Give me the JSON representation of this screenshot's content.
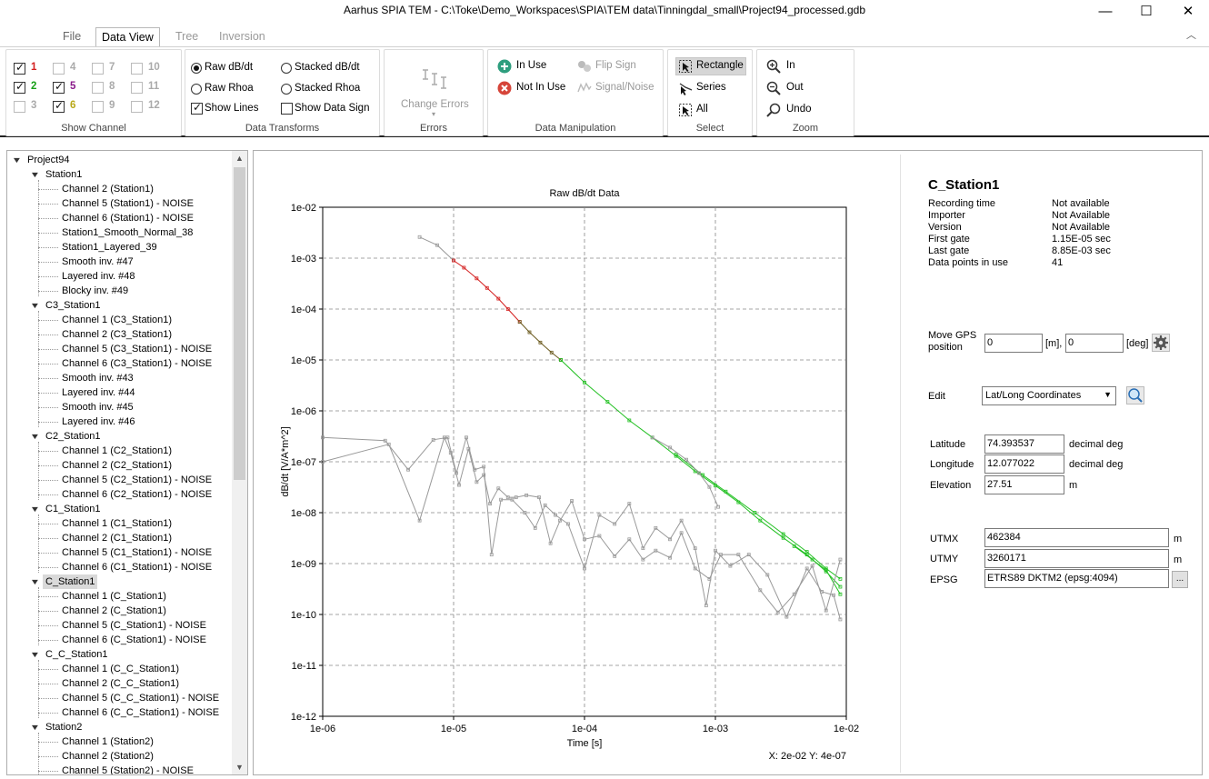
{
  "window": {
    "title": "Aarhus SPIA TEM - C:\\Toke\\Demo_Workspaces\\SPIA\\TEM data\\Tinningdal_small\\Project94_processed.gdb",
    "min": "—",
    "max": "☐",
    "close": "✕"
  },
  "tabs": [
    "File",
    "Data View",
    "Tree",
    "Inversion"
  ],
  "ribbon": {
    "show_channel": {
      "label": "Show Channel",
      "channels": [
        {
          "num": "1",
          "checked": true,
          "color": "#d42020"
        },
        {
          "num": "2",
          "checked": true,
          "color": "#18a018"
        },
        {
          "num": "3",
          "checked": false,
          "color": "#aaaaaa"
        },
        {
          "num": "4",
          "checked": false,
          "color": "#aaaaaa"
        },
        {
          "num": "5",
          "checked": true,
          "color": "#8a1a8a"
        },
        {
          "num": "6",
          "checked": true,
          "color": "#b8a818"
        },
        {
          "num": "7",
          "checked": false,
          "color": "#aaaaaa"
        },
        {
          "num": "8",
          "checked": false,
          "color": "#aaaaaa"
        },
        {
          "num": "9",
          "checked": false,
          "color": "#aaaaaa"
        },
        {
          "num": "10",
          "checked": false,
          "color": "#aaaaaa"
        },
        {
          "num": "11",
          "checked": false,
          "color": "#aaaaaa"
        },
        {
          "num": "12",
          "checked": false,
          "color": "#aaaaaa"
        }
      ]
    },
    "data_transforms": {
      "label": "Data Transforms",
      "raw_dbdt": "Raw dB/dt",
      "raw_rhoa": "Raw Rhoa",
      "stacked_dbdt": "Stacked dB/dt",
      "stacked_rhoa": "Stacked Rhoa",
      "show_lines": "Show Lines",
      "show_data_sign": "Show Data Sign"
    },
    "errors": {
      "label": "Errors",
      "change_errors": "Change Errors"
    },
    "data_manipulation": {
      "label": "Data Manipulation",
      "in_use": "In Use",
      "not_in_use": "Not In Use",
      "flip_sign": "Flip Sign",
      "signal_noise": "Signal/Noise"
    },
    "select": {
      "label": "Select",
      "rectangle": "Rectangle",
      "series": "Series",
      "all": "All"
    },
    "zoom": {
      "label": "Zoom",
      "in": "In",
      "out": "Out",
      "undo": "Undo"
    }
  },
  "tree": [
    {
      "level": 0,
      "label": "Project94",
      "expand": true
    },
    {
      "level": 1,
      "label": "Station1",
      "expand": true
    },
    {
      "level": 2,
      "label": "Channel 2 (Station1)"
    },
    {
      "level": 2,
      "label": "Channel 5 (Station1) - NOISE"
    },
    {
      "level": 2,
      "label": "Channel 6 (Station1) - NOISE"
    },
    {
      "level": 2,
      "label": "Station1_Smooth_Normal_38"
    },
    {
      "level": 2,
      "label": "Station1_Layered_39"
    },
    {
      "level": 2,
      "label": "Smooth inv.  #47"
    },
    {
      "level": 2,
      "label": "Layered inv.  #48"
    },
    {
      "level": 2,
      "label": "Blocky inv.  #49"
    },
    {
      "level": 1,
      "label": "C3_Station1",
      "expand": true
    },
    {
      "level": 2,
      "label": "Channel 1 (C3_Station1)"
    },
    {
      "level": 2,
      "label": "Channel 2 (C3_Station1)"
    },
    {
      "level": 2,
      "label": "Channel 5 (C3_Station1) - NOISE"
    },
    {
      "level": 2,
      "label": "Channel 6 (C3_Station1) - NOISE"
    },
    {
      "level": 2,
      "label": "Smooth inv.  #43"
    },
    {
      "level": 2,
      "label": "Layered inv.  #44"
    },
    {
      "level": 2,
      "label": "Smooth inv.  #45"
    },
    {
      "level": 2,
      "label": "Layered inv.  #46"
    },
    {
      "level": 1,
      "label": "C2_Station1",
      "expand": true
    },
    {
      "level": 2,
      "label": "Channel 1 (C2_Station1)"
    },
    {
      "level": 2,
      "label": "Channel 2 (C2_Station1)"
    },
    {
      "level": 2,
      "label": "Channel 5 (C2_Station1) - NOISE"
    },
    {
      "level": 2,
      "label": "Channel 6 (C2_Station1) - NOISE"
    },
    {
      "level": 1,
      "label": "C1_Station1",
      "expand": true
    },
    {
      "level": 2,
      "label": "Channel 1 (C1_Station1)"
    },
    {
      "level": 2,
      "label": "Channel 2 (C1_Station1)"
    },
    {
      "level": 2,
      "label": "Channel 5 (C1_Station1) - NOISE"
    },
    {
      "level": 2,
      "label": "Channel 6 (C1_Station1) - NOISE"
    },
    {
      "level": 1,
      "label": "C_Station1",
      "expand": true,
      "selected": true
    },
    {
      "level": 2,
      "label": "Channel 1 (C_Station1)"
    },
    {
      "level": 2,
      "label": "Channel 2 (C_Station1)"
    },
    {
      "level": 2,
      "label": "Channel 5 (C_Station1) - NOISE"
    },
    {
      "level": 2,
      "label": "Channel 6 (C_Station1) - NOISE"
    },
    {
      "level": 1,
      "label": "C_C_Station1",
      "expand": true
    },
    {
      "level": 2,
      "label": "Channel 1 (C_C_Station1)"
    },
    {
      "level": 2,
      "label": "Channel 2 (C_C_Station1)"
    },
    {
      "level": 2,
      "label": "Channel 5 (C_C_Station1) - NOISE"
    },
    {
      "level": 2,
      "label": "Channel 6 (C_C_Station1) - NOISE"
    },
    {
      "level": 1,
      "label": "Station2",
      "expand": true
    },
    {
      "level": 2,
      "label": "Channel 1 (Station2)"
    },
    {
      "level": 2,
      "label": "Channel 2 (Station2)"
    },
    {
      "level": 2,
      "label": "Channel 5 (Station2) - NOISE"
    }
  ],
  "chart_data": {
    "type": "line",
    "title": "Raw dB/dt Data",
    "xlabel": "Time [s]",
    "ylabel": "dB/dt [V/A*m^2]",
    "xscale": "log",
    "yscale": "log",
    "xlim": [
      1e-06,
      0.01
    ],
    "ylim": [
      1e-12,
      0.01
    ],
    "x_ticks": [
      "1e-06",
      "1e-05",
      "1e-04",
      "1e-03",
      "1e-02"
    ],
    "y_ticks": [
      "1e-02",
      "1e-03",
      "1e-04",
      "1e-05",
      "1e-06",
      "1e-07",
      "1e-08",
      "1e-09",
      "1e-10",
      "1e-11",
      "1e-12"
    ],
    "grid": true,
    "cursor_readout": "X: 2e-02 Y: 4e-07",
    "series": [
      {
        "color": "#999999",
        "points": [
          [
            5.5e-06,
            0.0026
          ],
          [
            7.5e-06,
            0.0018
          ],
          [
            1e-05,
            0.0009
          ]
        ]
      },
      {
        "color": "#d42020",
        "points": [
          [
            1e-05,
            0.0009
          ],
          [
            1.2e-05,
            0.00065
          ],
          [
            1.5e-05,
            0.0004
          ],
          [
            1.8e-05,
            0.00026
          ],
          [
            2.2e-05,
            0.00016
          ],
          [
            2.6e-05,
            0.0001
          ],
          [
            3.2e-05,
            5.6e-05
          ]
        ]
      },
      {
        "color": "#6b5a1e",
        "points": [
          [
            3.2e-05,
            5.6e-05
          ],
          [
            3.8e-05,
            3.5e-05
          ],
          [
            4.6e-05,
            2.2e-05
          ],
          [
            5.6e-05,
            1.4e-05
          ],
          [
            6.6e-05,
            1e-05
          ]
        ]
      },
      {
        "color": "#22c022",
        "points": [
          [
            6.6e-05,
            1e-05
          ],
          [
            0.0001,
            3.6e-06
          ],
          [
            0.00015,
            1.5e-06
          ],
          [
            0.00022,
            6.5e-07
          ],
          [
            0.00033,
            3e-07
          ],
          [
            0.0005,
            1.3e-07
          ],
          [
            0.0007,
            6.5e-08
          ],
          [
            0.001,
            3.4e-08
          ],
          [
            0.0015,
            1.6e-08
          ],
          [
            0.0022,
            7e-09
          ],
          [
            0.0033,
            3.2e-09
          ],
          [
            0.005,
            1.5e-09
          ],
          [
            0.007,
            7e-10
          ],
          [
            0.009,
            3.5e-10
          ]
        ]
      },
      {
        "color": "#22c022",
        "points": [
          [
            0.0005,
            1.4e-07
          ],
          [
            0.0008,
            5.5e-08
          ],
          [
            0.0012,
            2.6e-08
          ],
          [
            0.002,
            1e-08
          ],
          [
            0.0033,
            3.8e-09
          ],
          [
            0.005,
            1.7e-09
          ],
          [
            0.007,
            8e-10
          ],
          [
            0.009,
            5e-10
          ]
        ]
      },
      {
        "color": "#22c022",
        "points": [
          [
            0.004,
            2.2e-09
          ],
          [
            0.0055,
            1.2e-09
          ],
          [
            0.007,
            7.5e-10
          ],
          [
            0.009,
            2.5e-10
          ]
        ]
      },
      {
        "color": "#999999",
        "points": [
          [
            0.00033,
            3e-07
          ],
          [
            0.00045,
            1.9e-07
          ],
          [
            0.0006,
            1.1e-07
          ],
          [
            0.00075,
            6e-08
          ],
          [
            0.0009,
            3.2e-08
          ],
          [
            0.00105,
            1.3e-08
          ]
        ]
      },
      {
        "color": "#999999",
        "points": [
          [
            1e-06,
            1e-07
          ],
          [
            3.2e-06,
            2.2e-07
          ],
          [
            5.5e-06,
            7e-09
          ],
          [
            8.5e-06,
            3e-07
          ],
          [
            9.5e-06,
            1.5e-07
          ],
          [
            1.1e-05,
            3.5e-08
          ],
          [
            1.3e-05,
            1.8e-07
          ],
          [
            1.5e-05,
            4e-08
          ],
          [
            1.7e-05,
            5.5e-08
          ],
          [
            1.9e-05,
            1.5e-08
          ],
          [
            2.2e-05,
            3e-08
          ],
          [
            2.6e-05,
            2e-08
          ],
          [
            3e-05,
            2e-08
          ],
          [
            3.6e-05,
            2.2e-08
          ],
          [
            4.5e-05,
            2e-08
          ],
          [
            5.5e-05,
            2.5e-09
          ],
          [
            6.5e-05,
            7e-09
          ],
          [
            8e-05,
            1.7e-08
          ],
          [
            0.0001,
            3e-09
          ],
          [
            0.00013,
            3.5e-09
          ],
          [
            0.00017,
            1.4e-09
          ],
          [
            0.00022,
            3e-09
          ],
          [
            0.00028,
            1.2e-09
          ],
          [
            0.00035,
            1.8e-09
          ],
          [
            0.00045,
            1.3e-09
          ],
          [
            0.00055,
            4e-09
          ],
          [
            0.0007,
            8e-10
          ],
          [
            0.0009,
            5e-10
          ],
          [
            0.0011,
            1.5e-09
          ],
          [
            0.0015,
            1.5e-09
          ],
          [
            0.0022,
            3e-10
          ],
          [
            0.003,
            1.1e-10
          ],
          [
            0.004,
            2.5e-10
          ],
          [
            0.0055,
            9e-10
          ],
          [
            0.007,
            1.2e-10
          ],
          [
            0.009,
            1.2e-09
          ]
        ]
      },
      {
        "color": "#999999",
        "points": [
          [
            1e-06,
            3e-07
          ],
          [
            3e-06,
            2.6e-07
          ],
          [
            4.5e-06,
            7e-08
          ],
          [
            7e-06,
            2.7e-07
          ],
          [
            9e-06,
            3e-07
          ],
          [
            1.05e-05,
            6e-08
          ],
          [
            1.25e-05,
            3e-07
          ],
          [
            1.45e-05,
            7e-08
          ],
          [
            1.7e-05,
            8e-08
          ],
          [
            1.95e-05,
            1.5e-09
          ],
          [
            2.3e-05,
            1.8e-08
          ],
          [
            2.8e-05,
            1.8e-08
          ],
          [
            3.5e-05,
            1e-08
          ],
          [
            4.2e-05,
            5e-09
          ],
          [
            5e-05,
            1.4e-08
          ],
          [
            6e-05,
            9e-09
          ],
          [
            7.5e-05,
            6e-09
          ],
          [
            0.0001,
            8e-10
          ],
          [
            0.00013,
            9e-09
          ],
          [
            0.00017,
            6e-09
          ],
          [
            0.00022,
            1.5e-08
          ],
          [
            0.00028,
            2e-09
          ],
          [
            0.00035,
            5e-09
          ],
          [
            0.00045,
            3e-09
          ],
          [
            0.00055,
            7e-09
          ],
          [
            0.0007,
            2e-09
          ],
          [
            0.00085,
            1.5e-10
          ],
          [
            0.001,
            1.8e-09
          ],
          [
            0.0013,
            9e-10
          ],
          [
            0.0018,
            1.5e-09
          ],
          [
            0.0025,
            6e-10
          ],
          [
            0.0035,
            9e-11
          ],
          [
            0.005,
            8e-10
          ],
          [
            0.0065,
            2.8e-10
          ],
          [
            0.008,
            2.4e-10
          ],
          [
            0.009,
            8e-11
          ]
        ]
      }
    ]
  },
  "info": {
    "station": "C_Station1",
    "rows": [
      {
        "k": "Recording time",
        "v": "Not available"
      },
      {
        "k": "Importer",
        "v": "Not Available"
      },
      {
        "k": "Version",
        "v": "Not Available"
      },
      {
        "k": "First gate",
        "v": "1.15E-05 sec"
      },
      {
        "k": "Last gate",
        "v": "8.85E-03 sec"
      },
      {
        "k": "Data points in use",
        "v": "41"
      }
    ],
    "move_gps_label": "Move GPS position",
    "move_m": "0",
    "unit_m": "[m],",
    "move_deg": "0",
    "unit_deg": "[deg]",
    "edit_label": "Edit",
    "edit_value": "Lat/Long Coordinates",
    "latitude_label": "Latitude",
    "latitude": "74.393537",
    "longitude_label": "Longitude",
    "longitude": "12.077022",
    "elevation_label": "Elevation",
    "elevation": "27.51",
    "decimal_deg": "decimal deg",
    "m": "m",
    "utmx_label": "UTMX",
    "utmx": "462384",
    "utmy_label": "UTMY",
    "utmy": "3260171",
    "epsg_label": "EPSG",
    "epsg": "ETRS89 DKTM2 (epsg:4094)",
    "ellipsis": "..."
  }
}
